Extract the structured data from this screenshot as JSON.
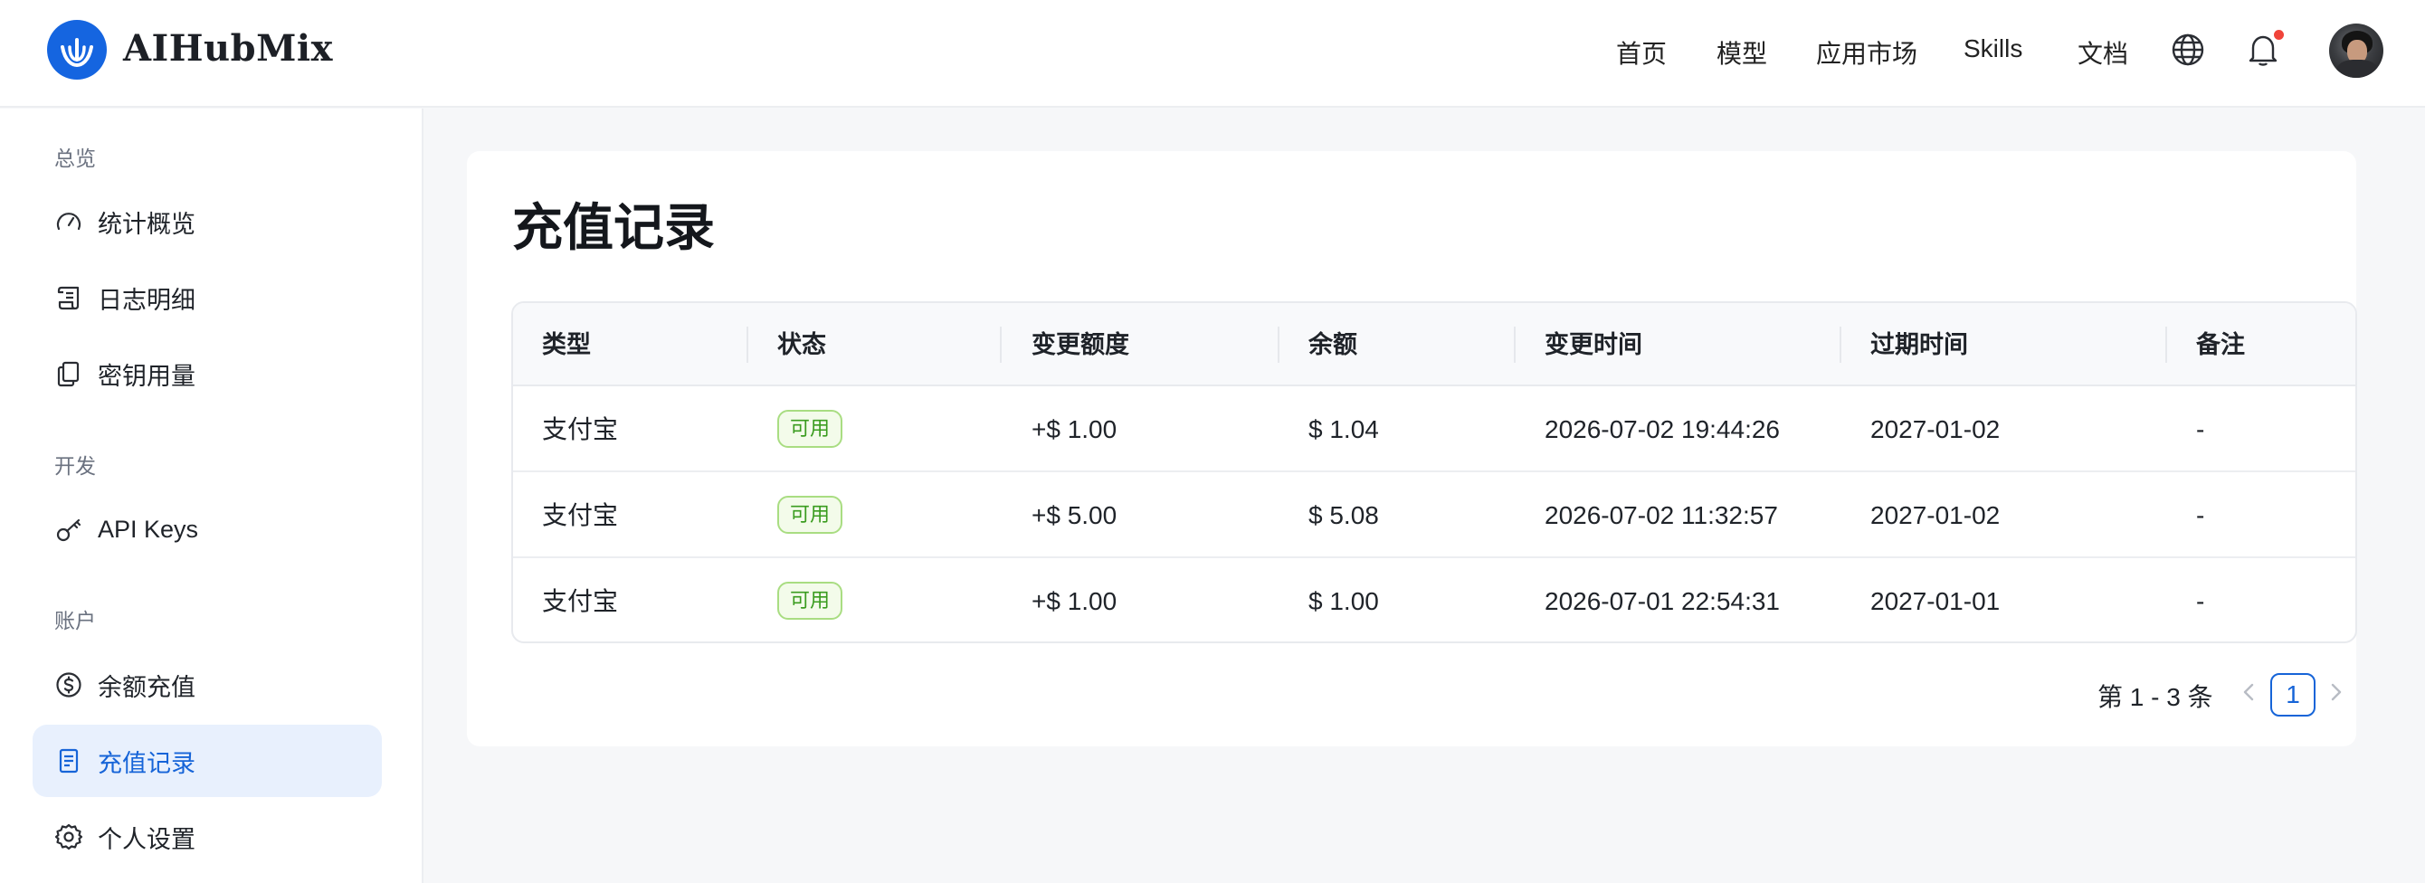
{
  "app": {
    "name": "AIHubMix"
  },
  "header": {
    "nav": [
      "首页",
      "模型",
      "应用市场",
      "Skills",
      "文档"
    ],
    "icons": [
      "globe-icon",
      "bell-icon",
      "avatar"
    ]
  },
  "sidebar": {
    "groups": [
      {
        "title": "总览",
        "items": [
          {
            "label": "统计概览",
            "icon": "gauge-icon"
          },
          {
            "label": "日志明细",
            "icon": "scroll-icon"
          },
          {
            "label": "密钥用量",
            "icon": "copy-icon"
          }
        ]
      },
      {
        "title": "开发",
        "items": [
          {
            "label": "API Keys",
            "icon": "key-icon"
          }
        ]
      },
      {
        "title": "账户",
        "items": [
          {
            "label": "余额充值",
            "icon": "dollar-icon"
          },
          {
            "label": "充值记录",
            "icon": "receipt-icon",
            "active": true
          },
          {
            "label": "个人设置",
            "icon": "gear-icon"
          }
        ]
      }
    ]
  },
  "main": {
    "title": "充值记录",
    "table": {
      "columns": [
        "类型",
        "状态",
        "变更额度",
        "余额",
        "变更时间",
        "过期时间",
        "备注"
      ],
      "rows": [
        {
          "type": "支付宝",
          "status": "可用",
          "change": "+$ 1.00",
          "balance": "$ 1.04",
          "changed_at": "2026-07-02 19:44:26",
          "expires_at": "2027-01-02",
          "note": "-"
        },
        {
          "type": "支付宝",
          "status": "可用",
          "change": "+$ 5.00",
          "balance": "$ 5.08",
          "changed_at": "2026-07-02 11:32:57",
          "expires_at": "2027-01-02",
          "note": "-"
        },
        {
          "type": "支付宝",
          "status": "可用",
          "change": "+$ 1.00",
          "balance": "$ 1.00",
          "changed_at": "2026-07-01 22:54:31",
          "expires_at": "2027-01-01",
          "note": "-"
        }
      ]
    },
    "pagination": {
      "total_text": "第 1 - 3 条",
      "current_page": "1"
    }
  },
  "colors": {
    "brand": "#1565e0",
    "active_bg": "#e8f0fd",
    "active_text": "#1664d8",
    "status_green": "#3a9c1f",
    "notify": "#f0443a"
  }
}
